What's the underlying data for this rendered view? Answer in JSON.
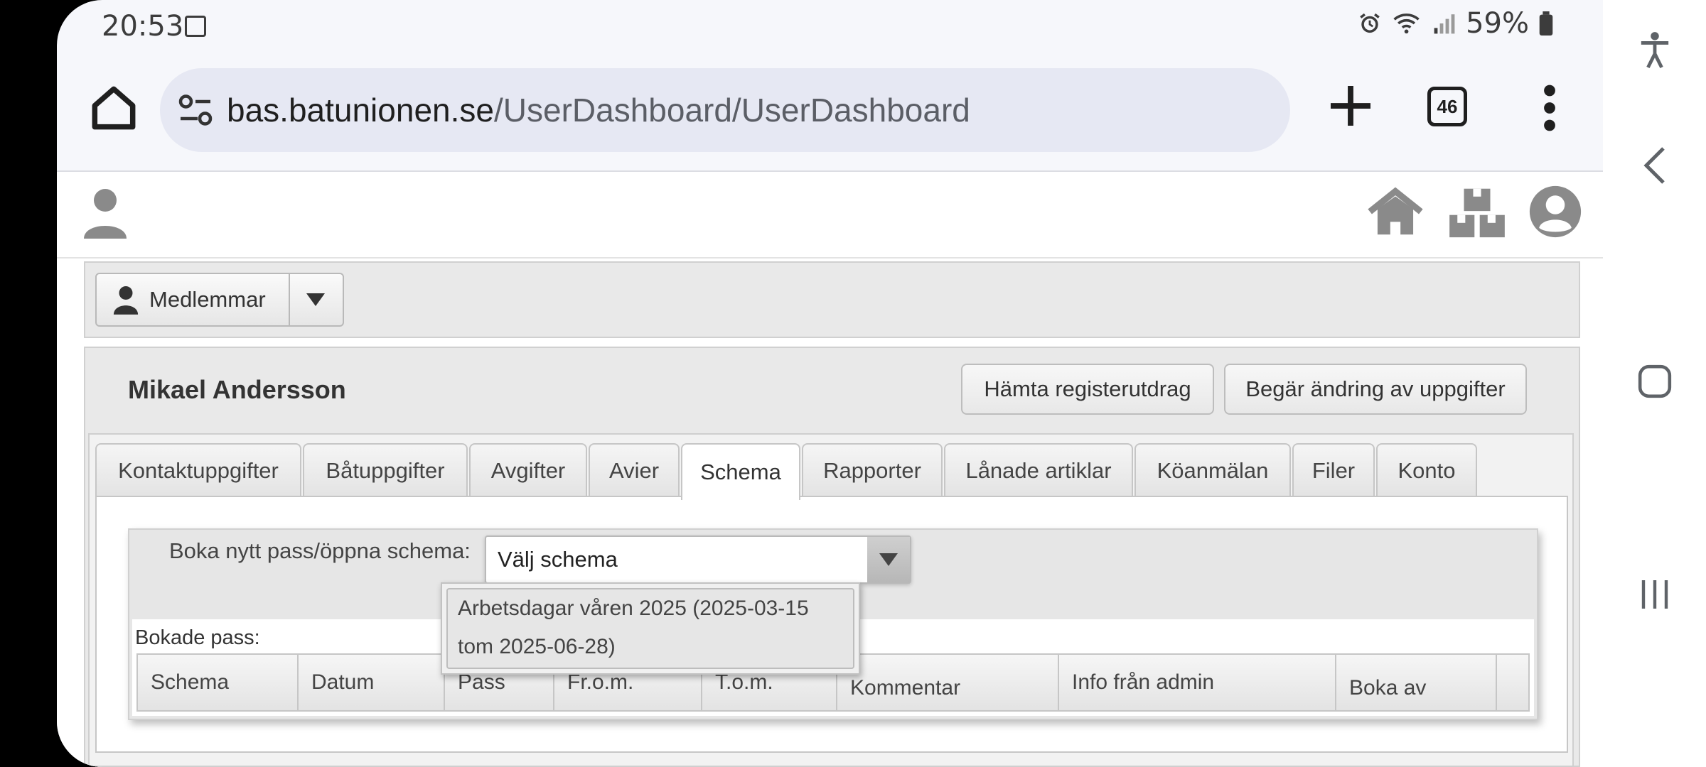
{
  "status_bar": {
    "time": "20:53",
    "battery": "59%"
  },
  "browser": {
    "url_host": "bas.batunionen.se",
    "url_path": "/UserDashboard/UserDashboard",
    "tab_count": "46"
  },
  "member_menu": {
    "label": "Medlemmar"
  },
  "profile": {
    "name": "Mikael Andersson",
    "btn_extract": "Hämta registerutdrag",
    "btn_change": "Begär ändring av uppgifter"
  },
  "tabs": [
    {
      "label": "Kontaktuppgifter"
    },
    {
      "label": "Båtuppgifter"
    },
    {
      "label": "Avgifter"
    },
    {
      "label": "Avier"
    },
    {
      "label": "Schema",
      "active": true
    },
    {
      "label": "Rapporter"
    },
    {
      "label": "Lånade artiklar"
    },
    {
      "label": "Köanmälan"
    },
    {
      "label": "Filer"
    },
    {
      "label": "Konto"
    }
  ],
  "schema": {
    "boka_label": "Boka nytt pass/öppna schema:",
    "select_value": "Välj schema",
    "option_line1": "Arbetsdagar våren 2025 (2025-03-15",
    "option_line2": "tom 2025-06-28)",
    "booked_label": "Bokade pass:",
    "columns": [
      "Schema",
      "Datum",
      "Pass",
      "Fr.o.m.",
      "T.o.m.",
      "Kommentar",
      "Info från admin",
      "Boka av",
      ""
    ]
  },
  "colors": {
    "chrome_bg": "#f6f7fb",
    "url_bg": "#e6e8f3",
    "panel_bg": "#e9e9e9"
  }
}
